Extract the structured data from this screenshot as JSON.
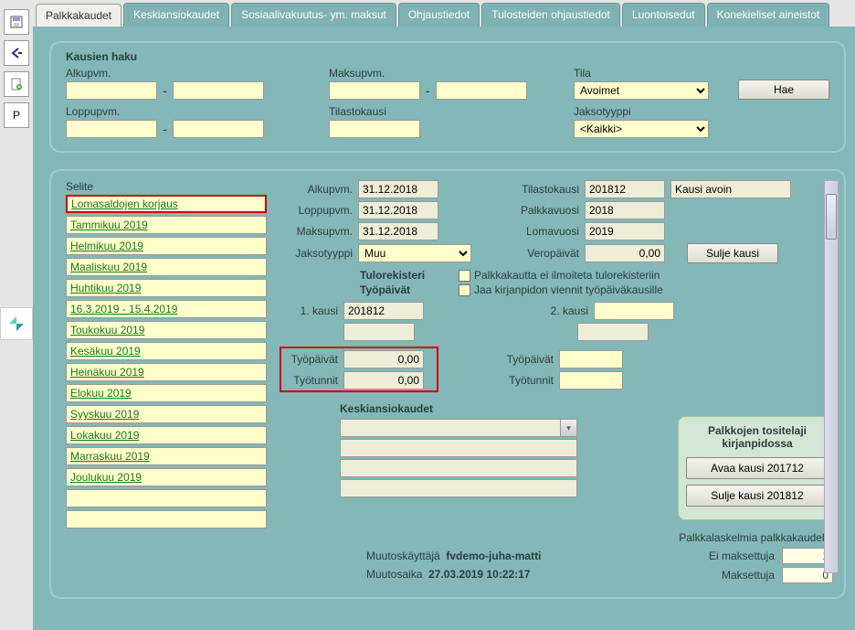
{
  "tabs": [
    "Palkkakaudet",
    "Keskiansiokaudet",
    "Sosiaalivakuutus- ym. maksut",
    "Ohjaustiedot",
    "Tulosteiden ohjaustiedot",
    "Luontoisedut",
    "Konekieliset aineistot"
  ],
  "activeTab": 0,
  "toolbar": {
    "p": "P"
  },
  "search": {
    "title": "Kausien haku",
    "alkupvm_label": "Alkupvm.",
    "loppupvm_label": "Loppupvm.",
    "maksupvm_label": "Maksupvm.",
    "tilastokausi_label": "Tilastokausi",
    "tila_label": "Tila",
    "tila_value": "Avoimet",
    "jaksotyyppi_label": "Jaksotyyppi",
    "jaksotyyppi_value": "<Kaikki>",
    "hae": "Hae"
  },
  "list": {
    "header": "Selite",
    "items": [
      "Lomasaldojen korjaus",
      "Tammikuu 2019",
      "Helmikuu 2019",
      "Maaliskuu 2019",
      "Huhtikuu 2019",
      "16.3.2019 - 15.4.2019",
      "Toukokuu 2019",
      "Kesäkuu 2019",
      "Heinäkuu 2019",
      "Elokuu 2019",
      "Syyskuu 2019",
      "Lokakuu 2019",
      "Marraskuu 2019",
      "Joulukuu 2019",
      "",
      ""
    ]
  },
  "details": {
    "alkupvm_label": "Alkupvm.",
    "alkupvm": "31.12.2018",
    "loppupvm_label": "Loppupvm.",
    "loppupvm": "31.12.2018",
    "maksupvm_label": "Maksupvm.",
    "maksupvm": "31.12.2018",
    "jaksotyyppi_label": "Jaksotyyppi",
    "jaksotyyppi": "Muu",
    "tilastokausi_label": "Tilastokausi",
    "tilastokausi": "201812",
    "palkkavuosi_label": "Palkkavuosi",
    "palkkavuosi": "2018",
    "lomavuosi_label": "Lomavuosi",
    "lomavuosi": "2019",
    "veropaivat_label": "Veropäivät",
    "veropaivat": "0,00",
    "status": "Kausi avoin",
    "sulje_kausi": "Sulje kausi",
    "tulorekisteri_label": "Tulorekisteri",
    "tulorekisteri_cb": "Palkkakautta ei ilmoiteta tulorekisteriin",
    "tyopaivat_section": "Työpäivät",
    "tyopaivat_cb": "Jaa kirjanpidon viennit työpäiväkausille",
    "kausi1_label": "1. kausi",
    "kausi1": "201812",
    "kausi2_label": "2. kausi",
    "kausi2": "",
    "tyopaivat_label": "Työpäivät",
    "tyopaivat1": "0,00",
    "tyopaivat2": "",
    "tyotunnit_label": "Työtunnit",
    "tyotunnit1": "0,00",
    "tyotunnit2": "",
    "keskians_title": "Keskiansiokaudet"
  },
  "rightBox": {
    "title": "Palkkojen tositelaji kirjanpidossa",
    "avaa": "Avaa kausi 201712",
    "sulje": "Sulje kausi 201812"
  },
  "stats": {
    "title": "Palkkalaskelmia palkkakaudella",
    "ei_maksettuja_label": "Ei maksettuja",
    "ei_maksettuja": "1",
    "maksettuja_label": "Maksettuja",
    "maksettuja": "0"
  },
  "footer": {
    "muutoskayttaja_label": "Muutoskäyttäjä",
    "muutoskayttaja": "fvdemo-juha-matti",
    "muutosaika_label": "Muutosaika",
    "muutosaika": "27.03.2019 10:22:17"
  }
}
